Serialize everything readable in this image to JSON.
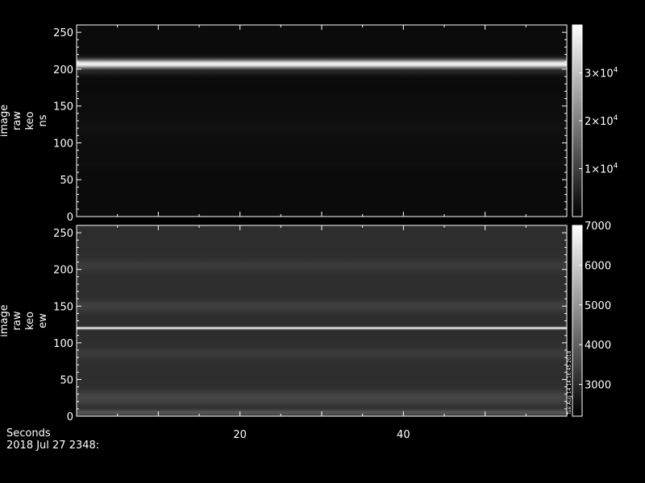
{
  "footer": {
    "axis_title": "Seconds",
    "timestamp": "2018 Jul 27 2348:",
    "x_ticks": [
      "20",
      "40"
    ]
  },
  "chart_data": [
    {
      "type": "heatmap",
      "ylabel_lines": [
        "image",
        "raw",
        "keo",
        "ns"
      ],
      "xlabel": "Seconds",
      "xlim": [
        0,
        60
      ],
      "ylim": [
        0,
        260
      ],
      "y_ticks": [
        0,
        50,
        100,
        150,
        200,
        250
      ],
      "x_ticks": [
        20,
        40
      ],
      "colorbar": {
        "range": [
          0,
          40000
        ],
        "tick_values": [
          10000,
          20000,
          30000
        ],
        "tick_labels": [
          "1×10",
          "2×10",
          "3×10"
        ],
        "tick_exponent": "4"
      },
      "bands": [
        {
          "y": 207,
          "intensity": 38000,
          "width": 6
        },
        {
          "y": 198,
          "intensity": 6000,
          "width": 6
        },
        {
          "y": 120,
          "intensity": 2500,
          "width": 20
        },
        {
          "y": 72,
          "intensity": 2200,
          "width": 6
        }
      ],
      "background_intensity": 1800
    },
    {
      "type": "heatmap",
      "ylabel_lines": [
        "image",
        "raw",
        "keo",
        "ew"
      ],
      "xlabel": "Seconds",
      "xlim": [
        0,
        60
      ],
      "ylim": [
        0,
        260
      ],
      "y_ticks": [
        0,
        50,
        100,
        150,
        200,
        250
      ],
      "x_ticks": [
        20,
        40
      ],
      "colorbar": {
        "range": [
          2200,
          7000
        ],
        "tick_values": [
          3000,
          4000,
          5000,
          6000,
          7000
        ],
        "tick_labels": [
          "3000",
          "4000",
          "5000",
          "6000",
          "7000"
        ],
        "side_text": "Tue Aug 14 14:16:45 2018"
      },
      "bands": [
        {
          "y": 120,
          "intensity": 7000,
          "width": 1.5
        },
        {
          "y": 150,
          "intensity": 3400,
          "width": 8
        },
        {
          "y": 205,
          "intensity": 3300,
          "width": 8
        },
        {
          "y": 85,
          "intensity": 3300,
          "width": 8
        },
        {
          "y": 25,
          "intensity": 3500,
          "width": 10
        },
        {
          "y": 5,
          "intensity": 3800,
          "width": 4
        }
      ],
      "background_intensity": 3050
    }
  ]
}
